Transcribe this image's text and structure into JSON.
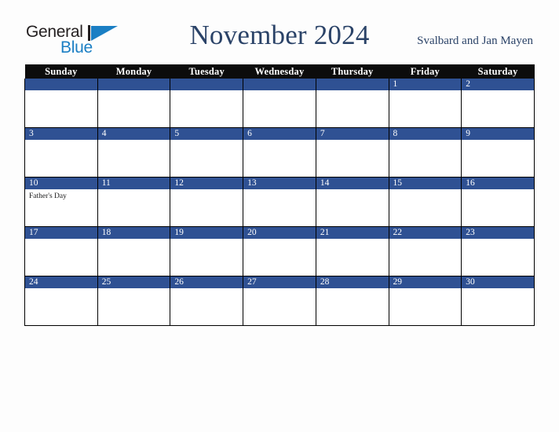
{
  "brand": {
    "name_part1": "General",
    "name_part2": "Blue",
    "triangle_icon": "triangle-right-icon",
    "accent_color": "#1b7fc4",
    "text_color": "#231f20"
  },
  "header": {
    "title": "November 2024",
    "subtitle": "Svalbard and Jan Mayen",
    "title_color": "#2b4368"
  },
  "calendar": {
    "month": "November",
    "year": "2024",
    "weekday_headers": [
      "Sunday",
      "Monday",
      "Tuesday",
      "Wednesday",
      "Thursday",
      "Friday",
      "Saturday"
    ],
    "header_bg": "#0c0c0c",
    "header_text_color": "#ffffff",
    "daybar_bg": "#2f5193",
    "daybar_text_color": "#ffffff",
    "cell_bg": "#ffffff",
    "border_color": "#000000",
    "weeks": [
      [
        {
          "date": "",
          "events": []
        },
        {
          "date": "",
          "events": []
        },
        {
          "date": "",
          "events": []
        },
        {
          "date": "",
          "events": []
        },
        {
          "date": "",
          "events": []
        },
        {
          "date": "1",
          "events": []
        },
        {
          "date": "2",
          "events": []
        }
      ],
      [
        {
          "date": "3",
          "events": []
        },
        {
          "date": "4",
          "events": []
        },
        {
          "date": "5",
          "events": []
        },
        {
          "date": "6",
          "events": []
        },
        {
          "date": "7",
          "events": []
        },
        {
          "date": "8",
          "events": []
        },
        {
          "date": "9",
          "events": []
        }
      ],
      [
        {
          "date": "10",
          "events": [
            "Father's Day"
          ]
        },
        {
          "date": "11",
          "events": []
        },
        {
          "date": "12",
          "events": []
        },
        {
          "date": "13",
          "events": []
        },
        {
          "date": "14",
          "events": []
        },
        {
          "date": "15",
          "events": []
        },
        {
          "date": "16",
          "events": []
        }
      ],
      [
        {
          "date": "17",
          "events": []
        },
        {
          "date": "18",
          "events": []
        },
        {
          "date": "19",
          "events": []
        },
        {
          "date": "20",
          "events": []
        },
        {
          "date": "21",
          "events": []
        },
        {
          "date": "22",
          "events": []
        },
        {
          "date": "23",
          "events": []
        }
      ],
      [
        {
          "date": "24",
          "events": []
        },
        {
          "date": "25",
          "events": []
        },
        {
          "date": "26",
          "events": []
        },
        {
          "date": "27",
          "events": []
        },
        {
          "date": "28",
          "events": []
        },
        {
          "date": "29",
          "events": []
        },
        {
          "date": "30",
          "events": []
        }
      ]
    ]
  }
}
